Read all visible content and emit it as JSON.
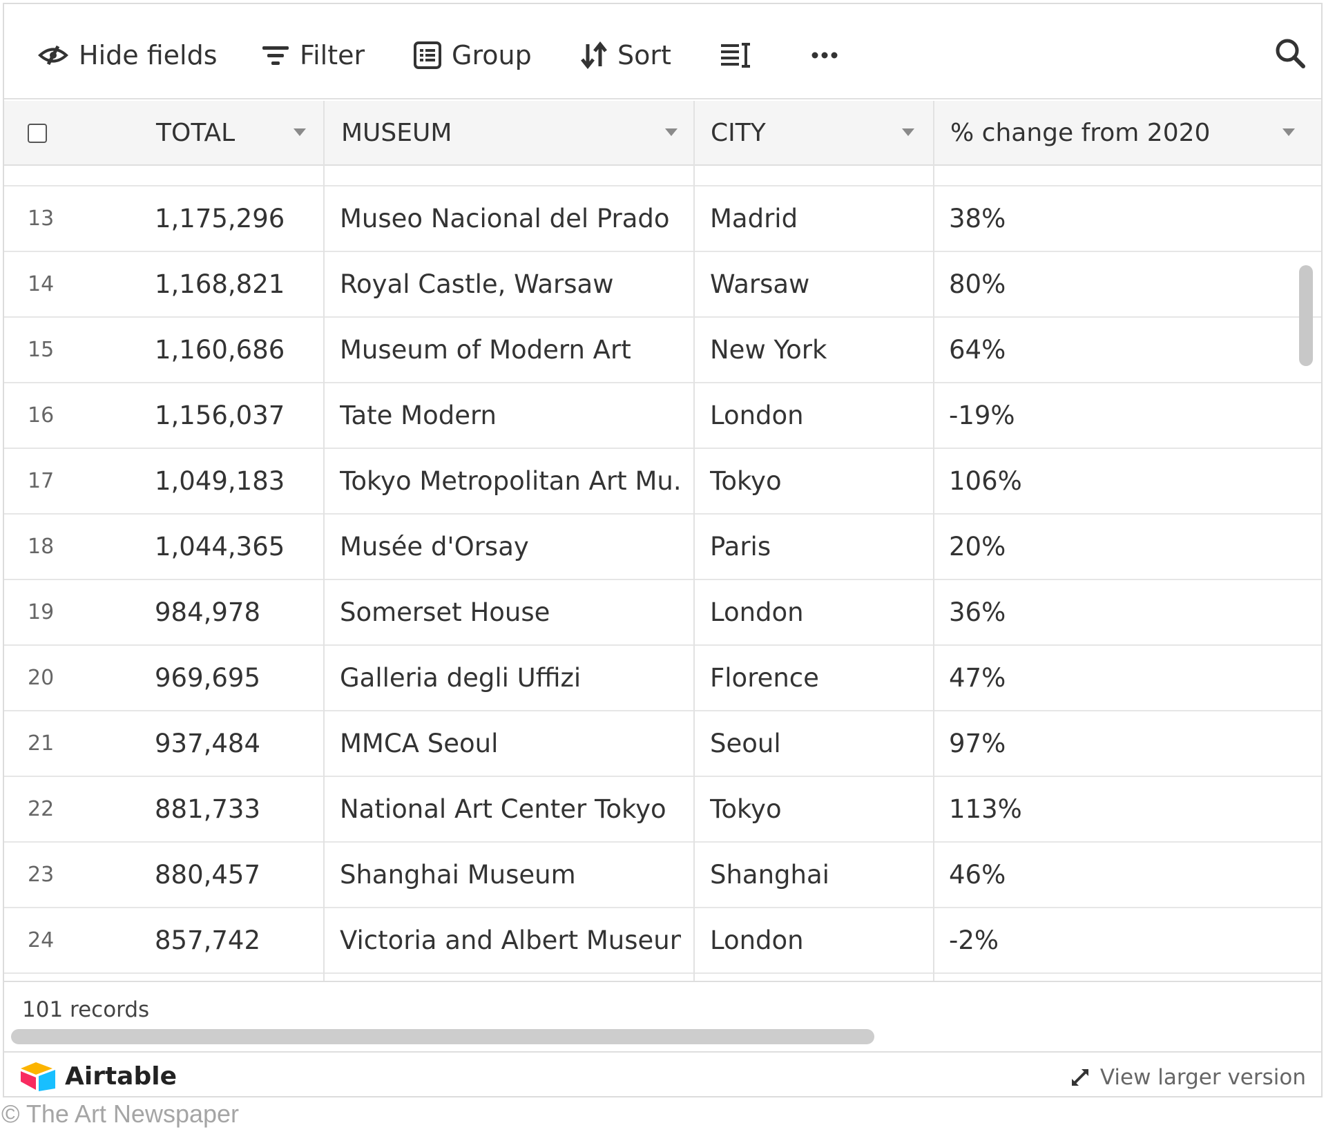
{
  "toolbar": {
    "hide_fields": "Hide fields",
    "filter": "Filter",
    "group": "Group",
    "sort": "Sort"
  },
  "columns": {
    "total": "TOTAL",
    "museum": "MUSEUM",
    "city": "CITY",
    "change": "% change from 2020"
  },
  "rows": [
    {
      "num": "13",
      "total": "1,175,296",
      "museum": "Museo Nacional del Prado",
      "city": "Madrid",
      "change": "38%"
    },
    {
      "num": "14",
      "total": "1,168,821",
      "museum": "Royal Castle, Warsaw",
      "city": "Warsaw",
      "change": "80%"
    },
    {
      "num": "15",
      "total": "1,160,686",
      "museum": "Museum of Modern Art",
      "city": "New York",
      "change": "64%"
    },
    {
      "num": "16",
      "total": "1,156,037",
      "museum": "Tate Modern",
      "city": "London",
      "change": "-19%"
    },
    {
      "num": "17",
      "total": "1,049,183",
      "museum": "Tokyo Metropolitan Art Mu...",
      "city": "Tokyo",
      "change": "106%"
    },
    {
      "num": "18",
      "total": "1,044,365",
      "museum": "Musée d'Orsay",
      "city": "Paris",
      "change": "20%"
    },
    {
      "num": "19",
      "total": "984,978",
      "museum": "Somerset House",
      "city": "London",
      "change": "36%"
    },
    {
      "num": "20",
      "total": "969,695",
      "museum": "Galleria degli Uffizi",
      "city": "Florence",
      "change": "47%"
    },
    {
      "num": "21",
      "total": "937,484",
      "museum": "MMCA Seoul",
      "city": "Seoul",
      "change": "97%"
    },
    {
      "num": "22",
      "total": "881,733",
      "museum": "National Art Center Tokyo",
      "city": "Tokyo",
      "change": "113%"
    },
    {
      "num": "23",
      "total": "880,457",
      "museum": "Shanghai Museum",
      "city": "Shanghai",
      "change": "46%"
    },
    {
      "num": "24",
      "total": "857,742",
      "museum": "Victoria and Albert Museum",
      "city": "London",
      "change": "-2%"
    }
  ],
  "footer": {
    "records": "101 records",
    "brand": "Airtable",
    "view_larger": "View larger version"
  },
  "copyright": "© The Art Newspaper",
  "colors": {
    "brand_yellow": "#fcb400",
    "brand_red": "#f82b60",
    "brand_blue": "#18bfff"
  }
}
